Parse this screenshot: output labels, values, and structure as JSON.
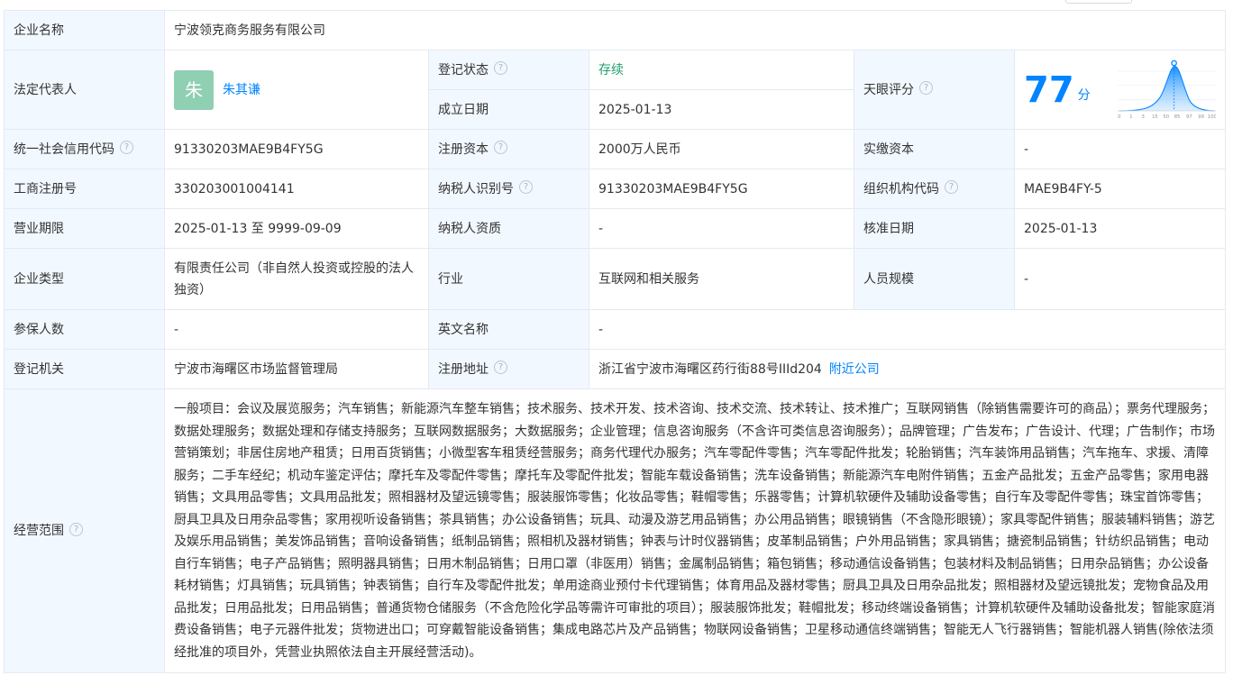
{
  "rows": {
    "company_name": {
      "label": "企业名称",
      "value": "宁波领克商务服务有限公司"
    },
    "legal_rep": {
      "label": "法定代表人",
      "avatar_char": "朱",
      "name": "朱其谦"
    },
    "reg_status": {
      "label": "登记状态",
      "value": "存续"
    },
    "found_date": {
      "label": "成立日期",
      "value": "2025-01-13"
    },
    "tianyan_score": {
      "label": "天眼评分",
      "score": "77",
      "unit": "分",
      "ticks": [
        "0",
        "1",
        "3",
        "15",
        "50",
        "85",
        "97",
        "99",
        "100"
      ]
    },
    "credit_code": {
      "label": "统一社会信用代码",
      "value": "91330203MAE9B4FY5G"
    },
    "reg_capital": {
      "label": "注册资本",
      "value": "2000万人民币"
    },
    "paid_capital": {
      "label": "实缴资本",
      "value": "-"
    },
    "biz_reg_no": {
      "label": "工商注册号",
      "value": "330203001004141"
    },
    "taxpayer_id": {
      "label": "纳税人识别号",
      "value": "91330203MAE9B4FY5G"
    },
    "org_code": {
      "label": "组织机构代码",
      "value": "MAE9B4FY-5"
    },
    "biz_term": {
      "label": "营业期限",
      "value": "2025-01-13 至 9999-09-09"
    },
    "taxpayer_qual": {
      "label": "纳税人资质",
      "value": "-"
    },
    "approval_date": {
      "label": "核准日期",
      "value": "2025-01-13"
    },
    "company_type": {
      "label": "企业类型",
      "value": "有限责任公司（非自然人投资或控股的法人独资）"
    },
    "industry": {
      "label": "行业",
      "value": "互联网和相关服务"
    },
    "staff_size": {
      "label": "人员规模",
      "value": "-"
    },
    "insured": {
      "label": "参保人数",
      "value": "-"
    },
    "english_name": {
      "label": "英文名称",
      "value": "-"
    },
    "reg_authority": {
      "label": "登记机关",
      "value": "宁波市海曙区市场监督管理局"
    },
    "reg_address": {
      "label": "注册地址",
      "value": "浙江省宁波市海曙区药行街88号IIId204",
      "link": "附近公司"
    },
    "biz_scope": {
      "label": "经营范围",
      "value": "一般项目：会议及展览服务；汽车销售；新能源汽车整车销售；技术服务、技术开发、技术咨询、技术交流、技术转让、技术推广；互联网销售（除销售需要许可的商品）；票务代理服务；数据处理服务；数据处理和存储支持服务；互联网数据服务；大数据服务；企业管理；信息咨询服务（不含许可类信息咨询服务）；品牌管理；广告发布；广告设计、代理；广告制作；市场营销策划；非居住房地产租赁；日用百货销售；小微型客车租赁经营服务；商务代理代办服务；汽车零配件零售；汽车零配件批发；轮胎销售；汽车装饰用品销售；汽车拖车、求援、清障服务；二手车经纪；机动车鉴定评估；摩托车及零配件零售；摩托车及零配件批发；智能车载设备销售；洗车设备销售；新能源汽车电附件销售；五金产品批发；五金产品零售；家用电器销售；文具用品零售；文具用品批发；照相器材及望远镜零售；服装服饰零售；化妆品零售；鞋帽零售；乐器零售；计算机软硬件及辅助设备零售；自行车及零配件零售；珠宝首饰零售；厨具卫具及日用杂品零售；家用视听设备销售；茶具销售；办公设备销售；玩具、动漫及游艺用品销售；办公用品销售；眼镜销售（不含隐形眼镜）；家具零配件销售；服装辅料销售；游艺及娱乐用品销售；美发饰品销售；音响设备销售；纸制品销售；照相机及器材销售；钟表与计时仪器销售；皮革制品销售；户外用品销售；家具销售；搪瓷制品销售；针纺织品销售；电动自行车销售；电子产品销售；照明器具销售；日用木制品销售；日用口罩（非医用）销售；金属制品销售；箱包销售；移动通信设备销售；包装材料及制品销售；日用杂品销售；办公设备耗材销售；灯具销售；玩具销售；钟表销售；自行车及零配件批发；单用途商业预付卡代理销售；体育用品及器材零售；厨具卫具及日用杂品批发；照相器材及望远镜批发；宠物食品及用品批发；日用品批发；日用品销售；普通货物仓储服务（不含危险化学品等需许可审批的项目）；服装服饰批发；鞋帽批发；移动终端设备销售；计算机软硬件及辅助设备批发；智能家庭消费设备销售；电子元器件批发；货物进出口；可穿戴智能设备销售；集成电路芯片及产品销售；物联网设备销售；卫星移动通信终端销售；智能无人飞行器销售；智能机器人销售(除依法须经批准的项目外，凭营业执照依法自主开展经营活动)。"
    }
  },
  "help_icon_glyph": "?"
}
